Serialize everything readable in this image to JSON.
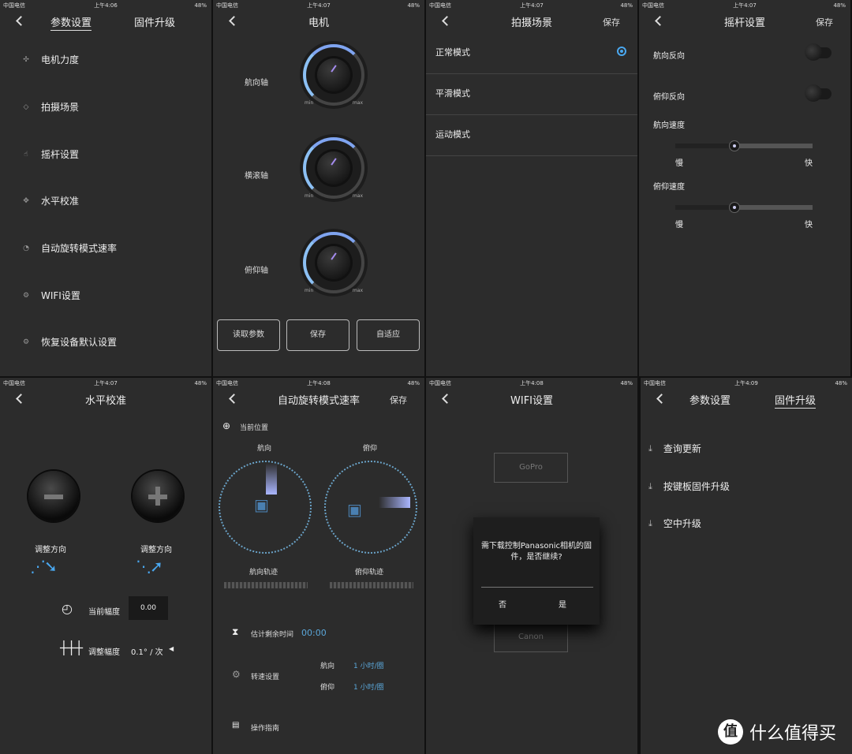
{
  "status": {
    "carrier": "中国电信",
    "battery": "48%",
    "times": [
      "上午4:06",
      "上午4:07",
      "上午4:07",
      "上午4:07",
      "上午4:07",
      "上午4:08",
      "上午4:08",
      "上午4:09"
    ]
  },
  "p1": {
    "tab_params": "参数设置",
    "tab_fw": "固件升级",
    "items": [
      "电机力度",
      "拍摄场景",
      "摇杆设置",
      "水平校准",
      "自动旋转模式速率",
      "WIFI设置",
      "恢复设备默认设置"
    ]
  },
  "p2": {
    "title": "电机",
    "knobs": [
      {
        "label": "航向轴",
        "min": "min",
        "max": "max"
      },
      {
        "label": "横滚轴",
        "min": "min",
        "max": "max"
      },
      {
        "label": "俯仰轴",
        "min": "min",
        "max": "max"
      }
    ],
    "buttons": [
      "读取参数",
      "保存",
      "自适应"
    ]
  },
  "p3": {
    "title": "拍摄场景",
    "save": "保存",
    "rows": [
      "正常模式",
      "平滑模式",
      "运动模式"
    ],
    "selected": 0
  },
  "p4": {
    "title": "摇杆设置",
    "save": "保存",
    "pan_reverse": "航向反向",
    "tilt_reverse": "俯仰反向",
    "pan_speed": "航向速度",
    "tilt_speed": "俯仰速度",
    "slow": "慢",
    "fast": "快",
    "pan_speed_value": 0.43,
    "tilt_speed_value": 0.43
  },
  "p5": {
    "title": "水平校准",
    "adjust_left": "调整方向",
    "adjust_right": "调整方向",
    "current_amp": "当前幅度",
    "current_value": "0.00",
    "adjust_amp": "调整幅度",
    "adjust_value": "0.1° / 次"
  },
  "p6": {
    "title": "自动旋转模式速率",
    "save": "保存",
    "current_pos": "当前位置",
    "pan": "航向",
    "tilt": "俯仰",
    "pan_track": "航向轨迹",
    "tilt_track": "俯仰轨迹",
    "remain": "估计剩余时间",
    "remain_value": "00:00",
    "speed_setting": "转速设置",
    "pan_label": "航向",
    "pan_speed": "1 小时/圈",
    "tilt_label": "俯仰",
    "tilt_speed": "1 小时/圈",
    "guide": "操作指南"
  },
  "p7": {
    "title": "WIFI设置",
    "gopro": "GoPro",
    "canon": "Canon",
    "dialog_text": "需下载控制Panasonic相机的固件，是否继续?",
    "no": "否",
    "yes": "是"
  },
  "p8": {
    "tab_params": "参数设置",
    "tab_fw": "固件升级",
    "items": [
      "查询更新",
      "按键板固件升级",
      "空中升级"
    ]
  },
  "watermark": {
    "logo": "值",
    "text": "什么值得买"
  }
}
